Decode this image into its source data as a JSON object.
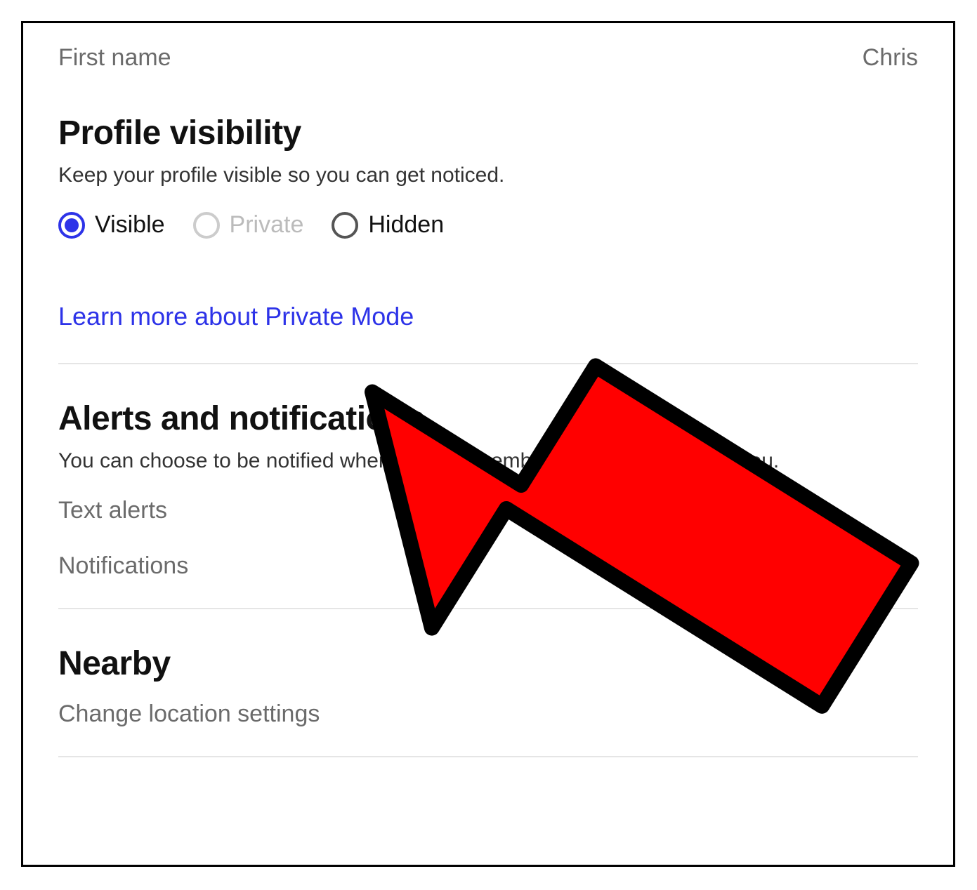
{
  "profile": {
    "first_name_label": "First name",
    "first_name_value": "Chris"
  },
  "visibility": {
    "title": "Profile visibility",
    "description": "Keep your profile visible so you can get noticed.",
    "options": {
      "visible": "Visible",
      "private": "Private",
      "hidden": "Hidden"
    },
    "selected": "visible",
    "learn_more": "Learn more about Private Mode"
  },
  "alerts": {
    "title": "Alerts and notifications",
    "description": "You can choose to be notified when another member takes an interest in you.",
    "text_alerts": "Text alerts",
    "notifications": "Notifications"
  },
  "nearby": {
    "title": "Nearby",
    "change_location": "Change location settings"
  }
}
